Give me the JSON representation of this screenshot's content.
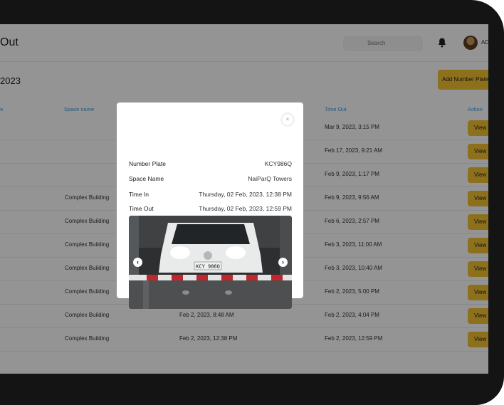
{
  "header": {
    "title": "Out",
    "search_placeholder": "Search",
    "user_name": "AD"
  },
  "section": {
    "title": "2023",
    "add_button": "Add Number Plate"
  },
  "table": {
    "headers": [
      "te",
      "Space name",
      "Time Out",
      "Action"
    ],
    "rows": [
      {
        "space": "",
        "time_in": "",
        "time_out": "Mar 9, 2023, 3:15 PM",
        "action": "View"
      },
      {
        "space": "",
        "time_in": "",
        "time_out": "Feb 17, 2023, 9:21 AM",
        "action": "View"
      },
      {
        "space": "",
        "time_in": "",
        "time_out": "Feb 9, 2023, 1:17 PM",
        "action": "View"
      },
      {
        "space": "Complex Building",
        "time_in": "",
        "time_out": "Feb 9, 2023, 9:56 AM",
        "action": "View"
      },
      {
        "space": "Complex Building",
        "time_in": "",
        "time_out": "Feb 6, 2023, 2:57 PM",
        "action": "View"
      },
      {
        "space": "Complex Building",
        "time_in": "",
        "time_out": "Feb 3, 2023, 11:00 AM",
        "action": "View"
      },
      {
        "space": "Complex Building",
        "time_in": "",
        "time_out": "Feb 3, 2023, 10:40 AM",
        "action": "View"
      },
      {
        "space": "Complex Building",
        "time_in": "",
        "time_out": "Feb 2, 2023, 5:00 PM",
        "action": "View"
      },
      {
        "space": "Complex Building",
        "time_in": "Feb 2, 2023, 8:48 AM",
        "time_out": "Feb 2, 2023, 4:04 PM",
        "action": "View"
      },
      {
        "space": "Complex Building",
        "time_in": "Feb 2, 2023, 12:38 PM",
        "time_out": "Feb 2, 2023, 12:59 PM",
        "action": "View"
      }
    ]
  },
  "modal": {
    "close": "×",
    "fields": [
      {
        "label": "Number Plate",
        "value": "KCY986Q"
      },
      {
        "label": "Space Name",
        "value": "NaiParQ Towers"
      },
      {
        "label": "Time In",
        "value": "Thursday, 02 Feb, 2023, 12:38 PM"
      },
      {
        "label": "Time Out",
        "value": "Thursday, 02 Feb, 2023, 12:59 PM"
      }
    ],
    "photo_plate": "KCY 986Q",
    "prev_arrow": "‹",
    "next_arrow": "›"
  },
  "colors": {
    "accent": "#f2c230",
    "header_blue": "#3b9ad9",
    "bezel": "#141414"
  }
}
